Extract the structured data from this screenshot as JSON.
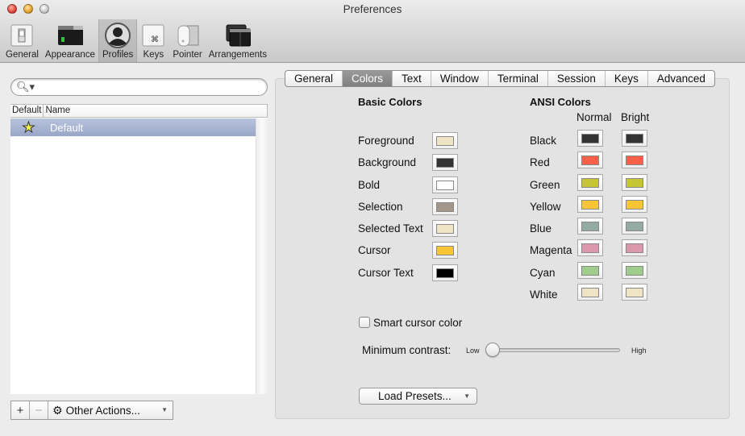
{
  "window": {
    "title": "Preferences"
  },
  "toolbar": {
    "items": [
      {
        "label": "General",
        "icon": "switch-icon"
      },
      {
        "label": "Appearance",
        "icon": "terminal-window-icon"
      },
      {
        "label": "Profiles",
        "icon": "user-silhouette-icon",
        "active": true
      },
      {
        "label": "Keys",
        "icon": "command-key-icon"
      },
      {
        "label": "Pointer",
        "icon": "mouse-icon"
      },
      {
        "label": "Arrangements",
        "icon": "window-arrangement-icon"
      }
    ]
  },
  "profiles": {
    "search": {
      "value": "",
      "placeholder": ""
    },
    "columns": [
      "Default",
      "Name"
    ],
    "rows": [
      {
        "is_default": true,
        "name": "Default",
        "selected": true
      }
    ],
    "add_label": "+",
    "remove_label": "−",
    "other_actions_label": "Other Actions..."
  },
  "tabs": {
    "items": [
      "General",
      "Colors",
      "Text",
      "Window",
      "Terminal",
      "Session",
      "Keys",
      "Advanced"
    ],
    "active": "Colors"
  },
  "colors": {
    "basic_title": "Basic Colors",
    "basic": [
      {
        "label": "Foreground",
        "color": "#efe4c4"
      },
      {
        "label": "Background",
        "color": "#333333"
      },
      {
        "label": "Bold",
        "color": "#ffffff"
      },
      {
        "label": "Selection",
        "color": "#a3978c"
      },
      {
        "label": "Selected Text",
        "color": "#efe4c4"
      },
      {
        "label": "Cursor",
        "color": "#f8c536"
      },
      {
        "label": "Cursor Text",
        "color": "#000000"
      }
    ],
    "ansi_title": "ANSI Colors",
    "ansi_normal_label": "Normal",
    "ansi_bright_label": "Bright",
    "ansi": [
      {
        "label": "Black",
        "normal": "#333333",
        "bright": "#333333"
      },
      {
        "label": "Red",
        "normal": "#fa5f4a",
        "bright": "#fa5f4a"
      },
      {
        "label": "Green",
        "normal": "#c5c536",
        "bright": "#c5c536"
      },
      {
        "label": "Yellow",
        "normal": "#f8c536",
        "bright": "#f8c536"
      },
      {
        "label": "Blue",
        "normal": "#93aba3",
        "bright": "#93aba3"
      },
      {
        "label": "Magenta",
        "normal": "#db97ab",
        "bright": "#db97ab"
      },
      {
        "label": "Cyan",
        "normal": "#a0cd8c",
        "bright": "#a0cd8c"
      },
      {
        "label": "White",
        "normal": "#efe4c4",
        "bright": "#efe4c4"
      }
    ],
    "smart_cursor_label": "Smart cursor color",
    "smart_cursor_checked": false,
    "min_contrast_label": "Minimum contrast:",
    "min_contrast_low": "Low",
    "min_contrast_high": "High",
    "min_contrast_value": 0,
    "load_presets_label": "Load Presets..."
  }
}
